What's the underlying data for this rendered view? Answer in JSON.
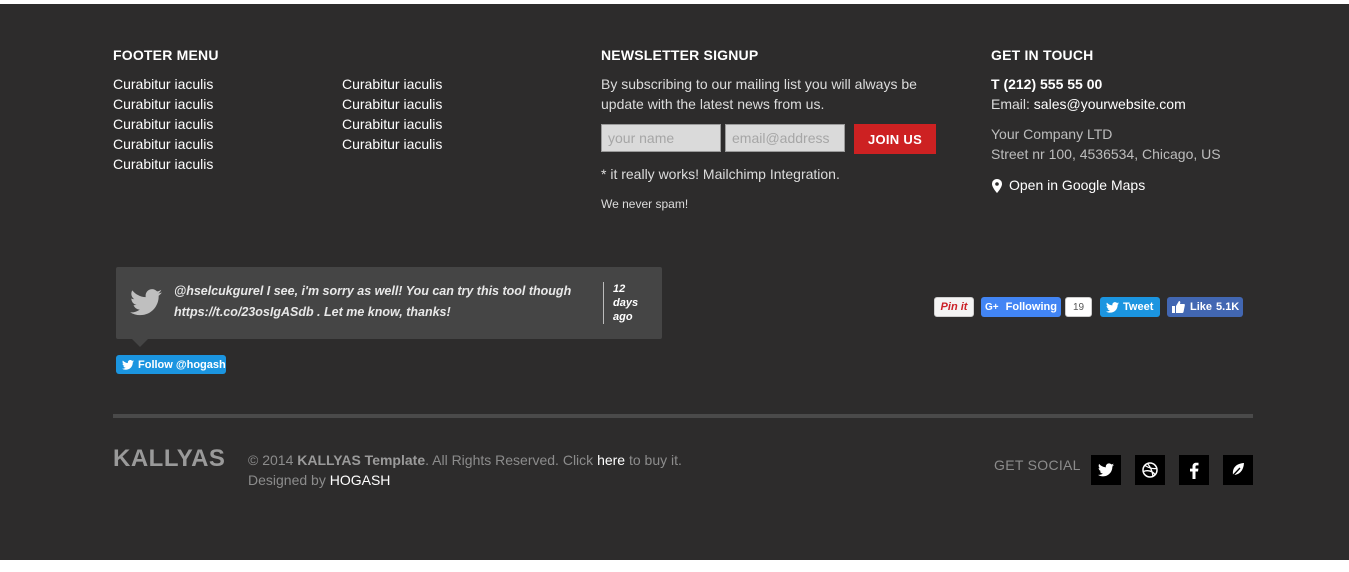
{
  "footer_menu": {
    "heading": "FOOTER MENU",
    "col1": [
      "Curabitur iaculis",
      "Curabitur iaculis",
      "Curabitur iaculis",
      "Curabitur iaculis",
      "Curabitur iaculis"
    ],
    "col2": [
      "Curabitur iaculis",
      "Curabitur iaculis",
      "Curabitur iaculis",
      "Curabitur iaculis"
    ]
  },
  "newsletter": {
    "heading": "NEWSLETTER SIGNUP",
    "desc_line1": "By subscribing to our mailing list you will always be",
    "desc_line2": "update with the latest news from us.",
    "name_placeholder": "your name",
    "email_placeholder": "email@address",
    "join_label": "JOIN US",
    "note": "* it really works! Mailchimp Integration.",
    "spam": "We never spam!"
  },
  "contact": {
    "heading": "GET IN TOUCH",
    "phone": "T (212) 555 55 00",
    "email_label": "Email:",
    "email": "sales@yourwebsite.com",
    "company": "Your Company LTD",
    "address": "Street nr 100, 4536534, Chicago, US",
    "maps_link": "Open in Google Maps"
  },
  "tweet": {
    "line1": "@hselcukgurel I see, i'm sorry as well! You can try this tool though",
    "line2": "https://t.co/23osIgASdb . Let me know, thanks!",
    "time1": "12",
    "time2": "days",
    "time3": "ago",
    "follow_label": "Follow @hogash"
  },
  "social_buttons": {
    "pinit": "Pin it",
    "gplus_prefix": "G+",
    "gplus_label": "Following",
    "gplus_count": "19",
    "tweet_label": "Tweet",
    "like_label": "Like",
    "like_count": "5.1K"
  },
  "bottom": {
    "logo": "KALLYAS",
    "copy_prefix": "© 2014",
    "copy_brand": "KALLYAS Template",
    "copy_mid": ". All Rights Reserved. Click",
    "copy_here": "here",
    "copy_suffix": "to buy it.",
    "designed_by": "Designed by",
    "designer": "HOGASH",
    "get_social": "GET SOCIAL",
    "icons": [
      "twitter-icon",
      "dribbble-icon",
      "facebook-icon",
      "leaf-icon"
    ]
  },
  "colors": {
    "background": "#2d2c2c",
    "accent_red": "#cd2122",
    "twitter_blue": "#1b95e0",
    "facebook_blue": "#4267b2",
    "gplus_blue": "#4285f4"
  }
}
